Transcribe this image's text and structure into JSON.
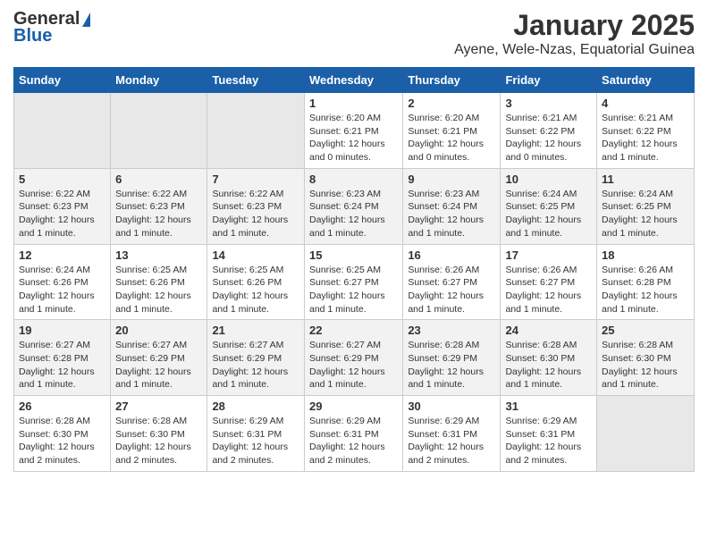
{
  "header": {
    "logo_general": "General",
    "logo_blue": "Blue",
    "title": "January 2025",
    "subtitle": "Ayene, Wele-Nzas, Equatorial Guinea"
  },
  "weekdays": [
    "Sunday",
    "Monday",
    "Tuesday",
    "Wednesday",
    "Thursday",
    "Friday",
    "Saturday"
  ],
  "weeks": [
    [
      {
        "day": "",
        "info": ""
      },
      {
        "day": "",
        "info": ""
      },
      {
        "day": "",
        "info": ""
      },
      {
        "day": "1",
        "info": "Sunrise: 6:20 AM\nSunset: 6:21 PM\nDaylight: 12 hours and 0 minutes."
      },
      {
        "day": "2",
        "info": "Sunrise: 6:20 AM\nSunset: 6:21 PM\nDaylight: 12 hours and 0 minutes."
      },
      {
        "day": "3",
        "info": "Sunrise: 6:21 AM\nSunset: 6:22 PM\nDaylight: 12 hours and 0 minutes."
      },
      {
        "day": "4",
        "info": "Sunrise: 6:21 AM\nSunset: 6:22 PM\nDaylight: 12 hours and 1 minute."
      }
    ],
    [
      {
        "day": "5",
        "info": "Sunrise: 6:22 AM\nSunset: 6:23 PM\nDaylight: 12 hours and 1 minute."
      },
      {
        "day": "6",
        "info": "Sunrise: 6:22 AM\nSunset: 6:23 PM\nDaylight: 12 hours and 1 minute."
      },
      {
        "day": "7",
        "info": "Sunrise: 6:22 AM\nSunset: 6:23 PM\nDaylight: 12 hours and 1 minute."
      },
      {
        "day": "8",
        "info": "Sunrise: 6:23 AM\nSunset: 6:24 PM\nDaylight: 12 hours and 1 minute."
      },
      {
        "day": "9",
        "info": "Sunrise: 6:23 AM\nSunset: 6:24 PM\nDaylight: 12 hours and 1 minute."
      },
      {
        "day": "10",
        "info": "Sunrise: 6:24 AM\nSunset: 6:25 PM\nDaylight: 12 hours and 1 minute."
      },
      {
        "day": "11",
        "info": "Sunrise: 6:24 AM\nSunset: 6:25 PM\nDaylight: 12 hours and 1 minute."
      }
    ],
    [
      {
        "day": "12",
        "info": "Sunrise: 6:24 AM\nSunset: 6:26 PM\nDaylight: 12 hours and 1 minute."
      },
      {
        "day": "13",
        "info": "Sunrise: 6:25 AM\nSunset: 6:26 PM\nDaylight: 12 hours and 1 minute."
      },
      {
        "day": "14",
        "info": "Sunrise: 6:25 AM\nSunset: 6:26 PM\nDaylight: 12 hours and 1 minute."
      },
      {
        "day": "15",
        "info": "Sunrise: 6:25 AM\nSunset: 6:27 PM\nDaylight: 12 hours and 1 minute."
      },
      {
        "day": "16",
        "info": "Sunrise: 6:26 AM\nSunset: 6:27 PM\nDaylight: 12 hours and 1 minute."
      },
      {
        "day": "17",
        "info": "Sunrise: 6:26 AM\nSunset: 6:27 PM\nDaylight: 12 hours and 1 minute."
      },
      {
        "day": "18",
        "info": "Sunrise: 6:26 AM\nSunset: 6:28 PM\nDaylight: 12 hours and 1 minute."
      }
    ],
    [
      {
        "day": "19",
        "info": "Sunrise: 6:27 AM\nSunset: 6:28 PM\nDaylight: 12 hours and 1 minute."
      },
      {
        "day": "20",
        "info": "Sunrise: 6:27 AM\nSunset: 6:29 PM\nDaylight: 12 hours and 1 minute."
      },
      {
        "day": "21",
        "info": "Sunrise: 6:27 AM\nSunset: 6:29 PM\nDaylight: 12 hours and 1 minute."
      },
      {
        "day": "22",
        "info": "Sunrise: 6:27 AM\nSunset: 6:29 PM\nDaylight: 12 hours and 1 minute."
      },
      {
        "day": "23",
        "info": "Sunrise: 6:28 AM\nSunset: 6:29 PM\nDaylight: 12 hours and 1 minute."
      },
      {
        "day": "24",
        "info": "Sunrise: 6:28 AM\nSunset: 6:30 PM\nDaylight: 12 hours and 1 minute."
      },
      {
        "day": "25",
        "info": "Sunrise: 6:28 AM\nSunset: 6:30 PM\nDaylight: 12 hours and 1 minute."
      }
    ],
    [
      {
        "day": "26",
        "info": "Sunrise: 6:28 AM\nSunset: 6:30 PM\nDaylight: 12 hours and 2 minutes."
      },
      {
        "day": "27",
        "info": "Sunrise: 6:28 AM\nSunset: 6:30 PM\nDaylight: 12 hours and 2 minutes."
      },
      {
        "day": "28",
        "info": "Sunrise: 6:29 AM\nSunset: 6:31 PM\nDaylight: 12 hours and 2 minutes."
      },
      {
        "day": "29",
        "info": "Sunrise: 6:29 AM\nSunset: 6:31 PM\nDaylight: 12 hours and 2 minutes."
      },
      {
        "day": "30",
        "info": "Sunrise: 6:29 AM\nSunset: 6:31 PM\nDaylight: 12 hours and 2 minutes."
      },
      {
        "day": "31",
        "info": "Sunrise: 6:29 AM\nSunset: 6:31 PM\nDaylight: 12 hours and 2 minutes."
      },
      {
        "day": "",
        "info": ""
      }
    ]
  ]
}
